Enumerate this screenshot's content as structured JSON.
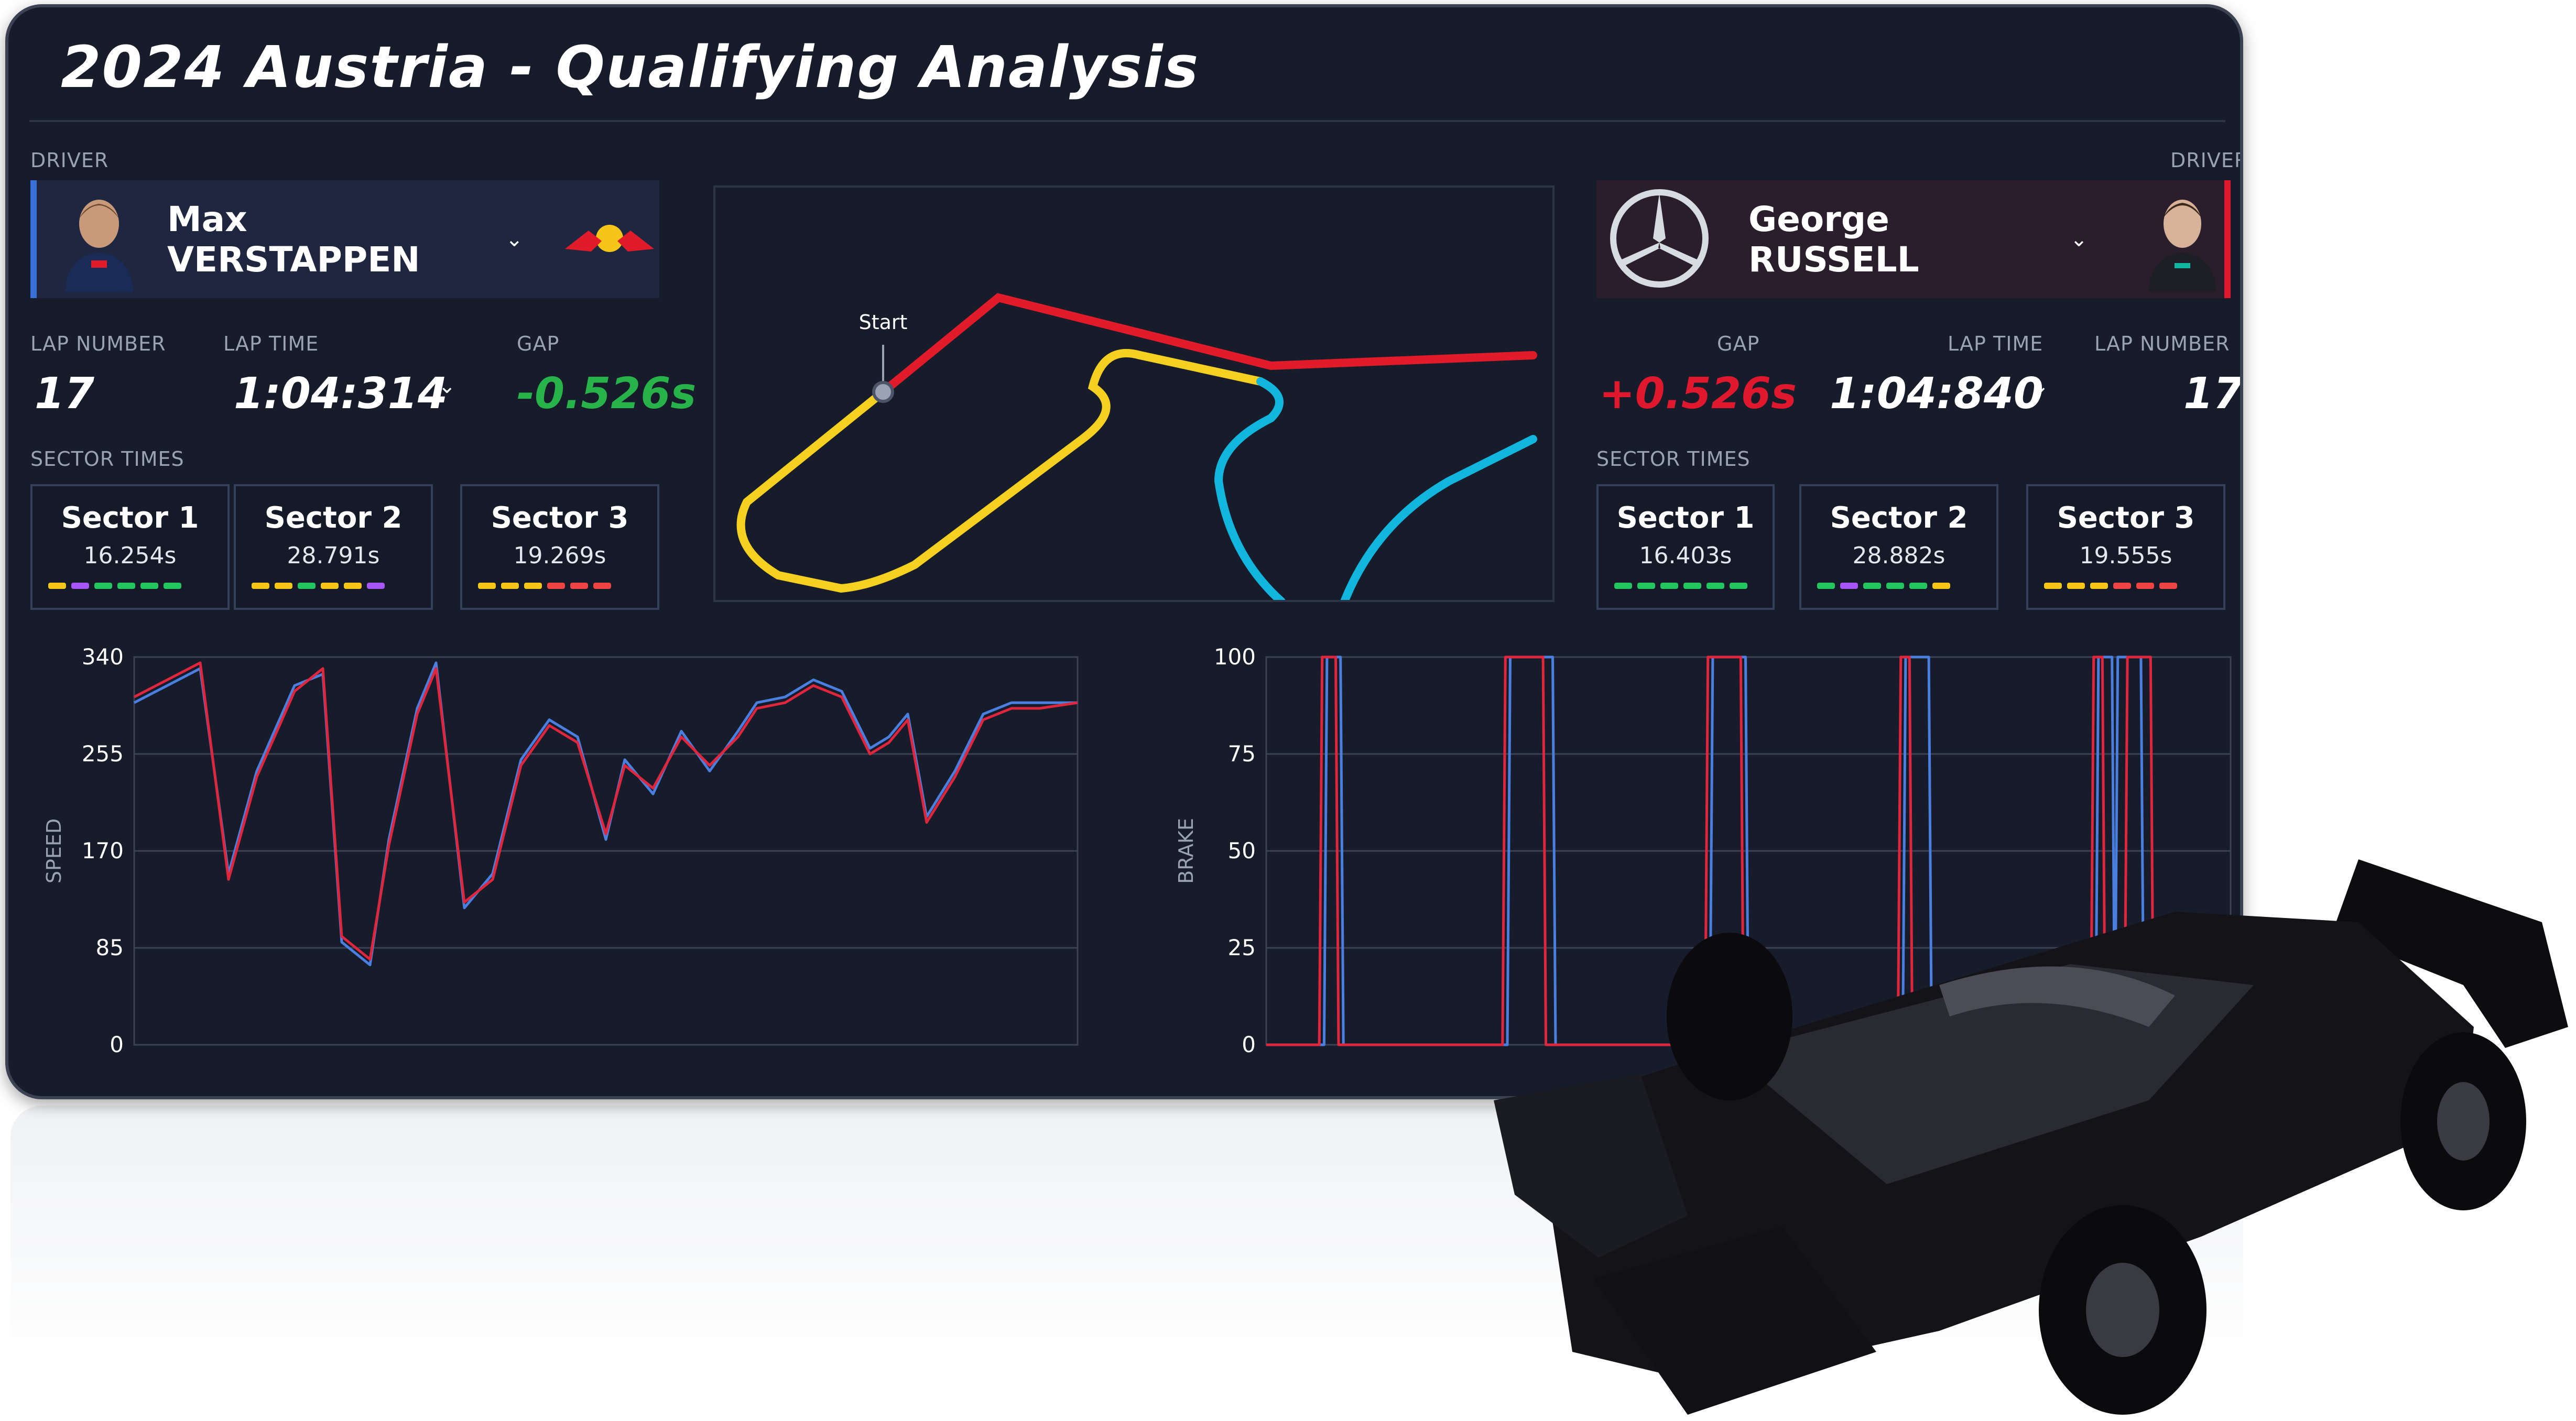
{
  "page": {
    "title": "2024 Austria - Qualifying Analysis"
  },
  "labels": {
    "driver": "DRIVER",
    "lap_number": "LAP NUMBER",
    "lap_time": "LAP TIME",
    "gap": "GAP",
    "sector_times": "SECTOR TIMES",
    "start": "Start"
  },
  "left_driver": {
    "name": "Max VERSTAPPEN",
    "team_icon": "red-bull-logo",
    "lap_number": "17",
    "lap_time": "1:04:314",
    "gap": "-0.526s",
    "gap_color": "#27b24a",
    "accent": "#3a6fd8",
    "sectors": [
      {
        "name": "Sector 1",
        "time": "16.254s",
        "minis": [
          "#f5c518",
          "#a855f7",
          "#22c55e",
          "#22c55e",
          "#22c55e",
          "#22c55e"
        ]
      },
      {
        "name": "Sector 2",
        "time": "28.791s",
        "minis": [
          "#f5c518",
          "#f5c518",
          "#22c55e",
          "#f5c518",
          "#f5c518",
          "#a855f7"
        ]
      },
      {
        "name": "Sector 3",
        "time": "19.269s",
        "minis": [
          "#f5c518",
          "#f5c518",
          "#f5c518",
          "#ef4444",
          "#ef4444",
          "#ef4444"
        ]
      }
    ]
  },
  "right_driver": {
    "name": "George RUSSELL",
    "team_icon": "mercedes-logo",
    "lap_number": "17",
    "lap_time": "1:04:840",
    "gap": "+0.526s",
    "gap_color": "#e0182d",
    "accent": "#e0182d",
    "sectors": [
      {
        "name": "Sector 1",
        "time": "16.403s",
        "minis": [
          "#22c55e",
          "#22c55e",
          "#22c55e",
          "#22c55e",
          "#22c55e",
          "#22c55e"
        ]
      },
      {
        "name": "Sector 2",
        "time": "28.882s",
        "minis": [
          "#22c55e",
          "#a855f7",
          "#22c55e",
          "#22c55e",
          "#22c55e",
          "#f5c518"
        ]
      },
      {
        "name": "Sector 3",
        "time": "19.555s",
        "minis": [
          "#f5c518",
          "#f5c518",
          "#f5c518",
          "#ef4444",
          "#ef4444",
          "#ef4444"
        ]
      }
    ]
  },
  "track": {
    "sector_colors": [
      "#e21b2a",
      "#f5d020",
      "#12b5dd"
    ]
  },
  "chart_data": [
    {
      "type": "line",
      "ylabel": "SPEED",
      "ylim": [
        0,
        340
      ],
      "yticks": [
        0,
        85,
        170,
        255,
        340
      ],
      "grid": true,
      "series": [
        {
          "color": "#4a7fe0",
          "x": [
            0,
            0.07,
            0.1,
            0.13,
            0.17,
            0.2,
            0.22,
            0.25,
            0.27,
            0.3,
            0.32,
            0.35,
            0.38,
            0.41,
            0.44,
            0.47,
            0.5,
            0.52,
            0.55,
            0.58,
            0.61,
            0.64,
            0.66,
            0.69,
            0.72,
            0.75,
            0.78,
            0.8,
            0.82,
            0.84,
            0.87,
            0.9,
            0.93,
            0.96,
            1.0
          ],
          "y": [
            300,
            330,
            150,
            240,
            315,
            325,
            90,
            70,
            180,
            295,
            335,
            120,
            150,
            250,
            285,
            270,
            180,
            250,
            220,
            275,
            240,
            275,
            300,
            305,
            320,
            310,
            260,
            270,
            290,
            200,
            240,
            290,
            300,
            300,
            300
          ]
        },
        {
          "color": "#e0263c",
          "x": [
            0,
            0.07,
            0.1,
            0.13,
            0.17,
            0.2,
            0.22,
            0.25,
            0.27,
            0.3,
            0.32,
            0.35,
            0.38,
            0.41,
            0.44,
            0.47,
            0.5,
            0.52,
            0.55,
            0.58,
            0.61,
            0.64,
            0.66,
            0.69,
            0.72,
            0.75,
            0.78,
            0.8,
            0.82,
            0.84,
            0.87,
            0.9,
            0.93,
            0.96,
            1.0
          ],
          "y": [
            305,
            335,
            145,
            235,
            310,
            330,
            95,
            75,
            175,
            290,
            330,
            125,
            145,
            245,
            280,
            265,
            185,
            245,
            225,
            270,
            245,
            270,
            295,
            300,
            315,
            305,
            255,
            265,
            285,
            195,
            235,
            285,
            295,
            295,
            300
          ]
        }
      ]
    },
    {
      "type": "line",
      "ylabel": "BRAKE",
      "ylim": [
        0,
        100
      ],
      "yticks": [
        0,
        25,
        50,
        75,
        100
      ],
      "grid": true,
      "series": [
        {
          "color": "#4a7fe0",
          "segments": [
            [
              0.06,
              0.08
            ],
            [
              0.25,
              0.3
            ],
            [
              0.46,
              0.5
            ],
            [
              0.66,
              0.69
            ],
            [
              0.86,
              0.88
            ],
            [
              0.88,
              0.91
            ]
          ]
        },
        {
          "color": "#e0263c",
          "segments": [
            [
              0.055,
              0.075
            ],
            [
              0.245,
              0.29
            ],
            [
              0.455,
              0.495
            ],
            [
              0.655,
              0.67
            ],
            [
              0.855,
              0.87
            ],
            [
              0.89,
              0.92
            ]
          ]
        }
      ]
    }
  ]
}
